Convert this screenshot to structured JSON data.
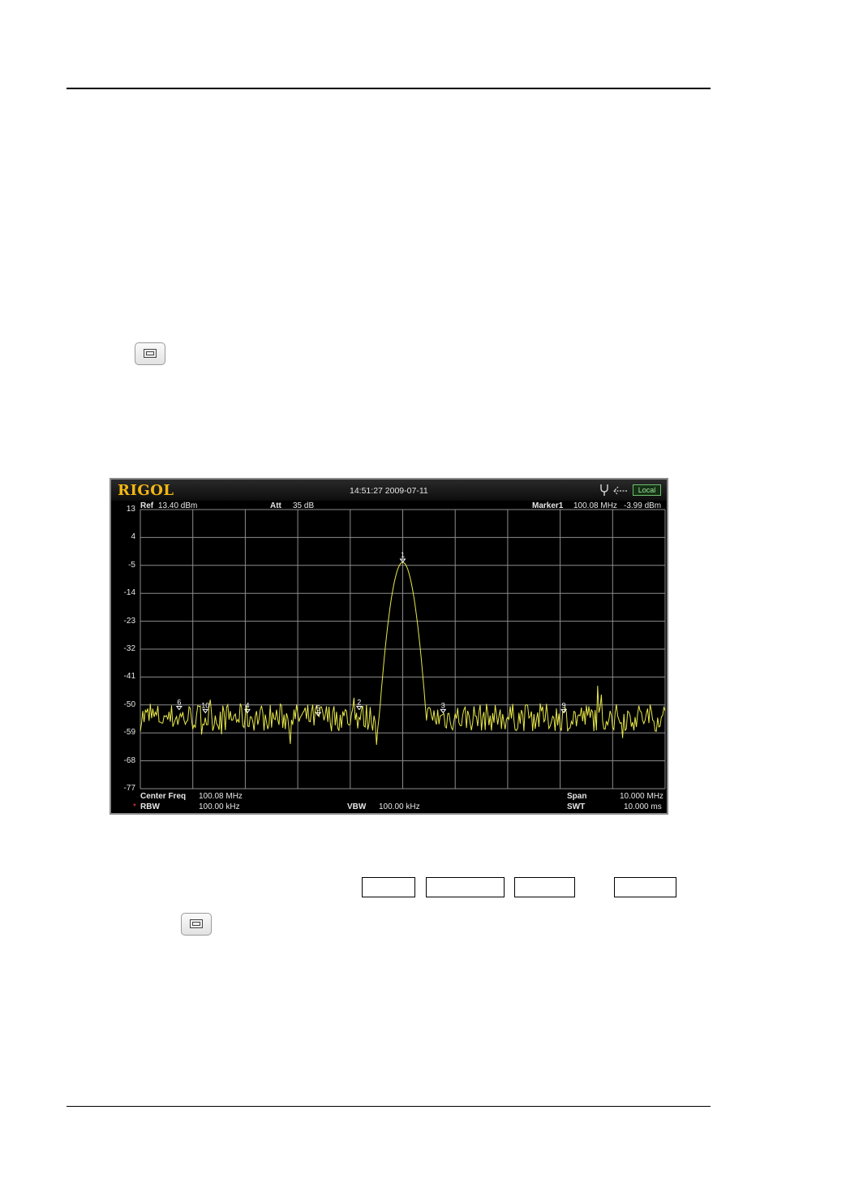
{
  "screen": {
    "logo": "RIGOL",
    "datetime": "14:51:27 2009-07-11",
    "status_badge": "Local",
    "top_info": {
      "ref_label": "Ref",
      "ref_value": "13.40 dBm",
      "att_label": "Att",
      "att_value": "35 dB",
      "marker_label": "Marker1",
      "marker_freq": "100.08 MHz",
      "marker_amp": "-3.99 dBm"
    },
    "bottom_info": {
      "center_label": "Center Freq",
      "center_value": "100.08 MHz",
      "rbw_star": "*",
      "rbw_label": "RBW",
      "rbw_value": "100.00 kHz",
      "vbw_label": "VBW",
      "vbw_value": "100.00 kHz",
      "span_label": "Span",
      "span_value": "10.000 MHz",
      "swt_label": "SWT",
      "swt_value": "10.000 ms"
    },
    "colors": {
      "trace": "#e8e84a",
      "grid": "#8c8c8c",
      "logo": "#f2b713",
      "badge": "#9ee89e"
    }
  },
  "chart_data": {
    "type": "line",
    "title": "",
    "xlabel": "",
    "ylabel": "",
    "y_ticks": [
      "13",
      "4",
      "-5",
      "-14",
      "-23",
      "-32",
      "-41",
      "-50",
      "-59",
      "-68",
      "-77"
    ],
    "ylim": [
      -77,
      13
    ],
    "xlim": [
      95.08,
      105.08
    ],
    "x_unit": "MHz",
    "grid": true,
    "noise_floor_dbm": -54,
    "peak": {
      "x": 100.08,
      "y": -3.99
    },
    "markers": [
      {
        "label": "1",
        "x": 100.08,
        "y": -3.99
      },
      {
        "label": "2",
        "x": 99.25,
        "y": -51.5
      },
      {
        "label": "3",
        "x": 100.85,
        "y": -52.5
      },
      {
        "label": "4",
        "x": 97.12,
        "y": -52.5
      },
      {
        "label": "5",
        "x": 98.47,
        "y": -53.5
      },
      {
        "label": "6",
        "x": 95.82,
        "y": -51.5
      },
      {
        "label": "9",
        "x": 103.15,
        "y": -52.5
      },
      {
        "label": "10",
        "x": 96.32,
        "y": -52.5
      }
    ]
  }
}
